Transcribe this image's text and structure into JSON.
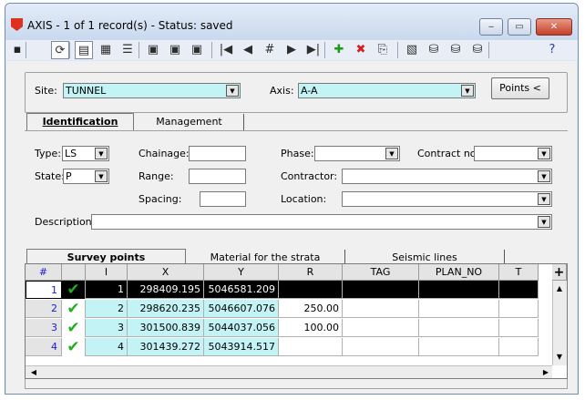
{
  "window": {
    "title": "AXIS - 1 of 1 record(s) - Status: saved",
    "minimize_glyph": "‒",
    "maximize_glyph": "▭",
    "close_glyph": "✕"
  },
  "toolbar": {
    "items": [
      {
        "icon": "save-icon",
        "glyph": "▪"
      },
      {
        "icon": "refresh-icon",
        "glyph": "⟳"
      },
      {
        "icon": "form-view-icon",
        "glyph": "▤"
      },
      {
        "icon": "table-view-icon",
        "glyph": "▦"
      },
      {
        "icon": "list-view-icon",
        "glyph": "☰"
      },
      {
        "icon": "print-icon",
        "glyph": "▣"
      },
      {
        "icon": "print-preview-icon",
        "glyph": "▣"
      },
      {
        "icon": "print-cancel-icon",
        "glyph": "▣"
      },
      {
        "icon": "first-record-icon",
        "glyph": "|◀"
      },
      {
        "icon": "prev-record-icon",
        "glyph": "◀"
      },
      {
        "icon": "goto-record-icon",
        "glyph": "#"
      },
      {
        "icon": "next-record-icon",
        "glyph": "▶"
      },
      {
        "icon": "last-record-icon",
        "glyph": "▶|"
      },
      {
        "icon": "add-record-icon",
        "glyph": "✚"
      },
      {
        "icon": "delete-record-icon",
        "glyph": "✖"
      },
      {
        "icon": "copy-record-icon",
        "glyph": "⎘"
      },
      {
        "icon": "attachment-icon",
        "glyph": "▧"
      },
      {
        "icon": "database-link-icon",
        "glyph": "⛁"
      },
      {
        "icon": "database-export-icon",
        "glyph": "⛁"
      },
      {
        "icon": "database-import-icon",
        "glyph": "⛁"
      },
      {
        "icon": "help-icon",
        "glyph": "?"
      }
    ]
  },
  "header": {
    "site_label": "Site:",
    "site_value": "TUNNEL",
    "axis_label": "Axis:",
    "axis_value": "A-A",
    "points_button": "Points <"
  },
  "tabs": {
    "identification": "Identification",
    "management": "Management"
  },
  "form": {
    "type_label": "Type:",
    "type_value": "LS",
    "state_label": "State:",
    "state_value": "P",
    "chainage_label": "Chainage:",
    "range_label": "Range:",
    "spacing_label": "Spacing:",
    "phase_label": "Phase:",
    "contract_label": "Contract no.",
    "contractor_label": "Contractor:",
    "location_label": "Location:",
    "description_label": "Description:"
  },
  "lower_tabs": {
    "survey_points": "Survey points",
    "material": "Material for the strata",
    "seismic": "Seismic lines"
  },
  "grid": {
    "columns": [
      "#",
      "",
      "I",
      "X",
      "Y",
      "R",
      "TAG",
      "PLAN_NO",
      "T"
    ],
    "add_glyph": "+",
    "rows": [
      {
        "num": "1",
        "i": "1",
        "x": "298409.195",
        "y": "5046581.209",
        "r": "",
        "tag": "",
        "plan_no": "",
        "t": "",
        "check": "✔"
      },
      {
        "num": "2",
        "i": "2",
        "x": "298620.235",
        "y": "5046607.076",
        "r": "250.00",
        "tag": "",
        "plan_no": "",
        "t": "",
        "check": "✔"
      },
      {
        "num": "3",
        "i": "3",
        "x": "301500.839",
        "y": "5044037.056",
        "r": "100.00",
        "tag": "",
        "plan_no": "",
        "t": "",
        "check": "✔"
      },
      {
        "num": "4",
        "i": "4",
        "x": "301439.272",
        "y": "5043914.517",
        "r": "",
        "tag": "",
        "plan_no": "",
        "t": "",
        "check": "✔"
      }
    ]
  },
  "scroll": {
    "up": "▲",
    "down": "▼",
    "left": "◀",
    "right": "▶",
    "combo_arrow": "▼"
  }
}
